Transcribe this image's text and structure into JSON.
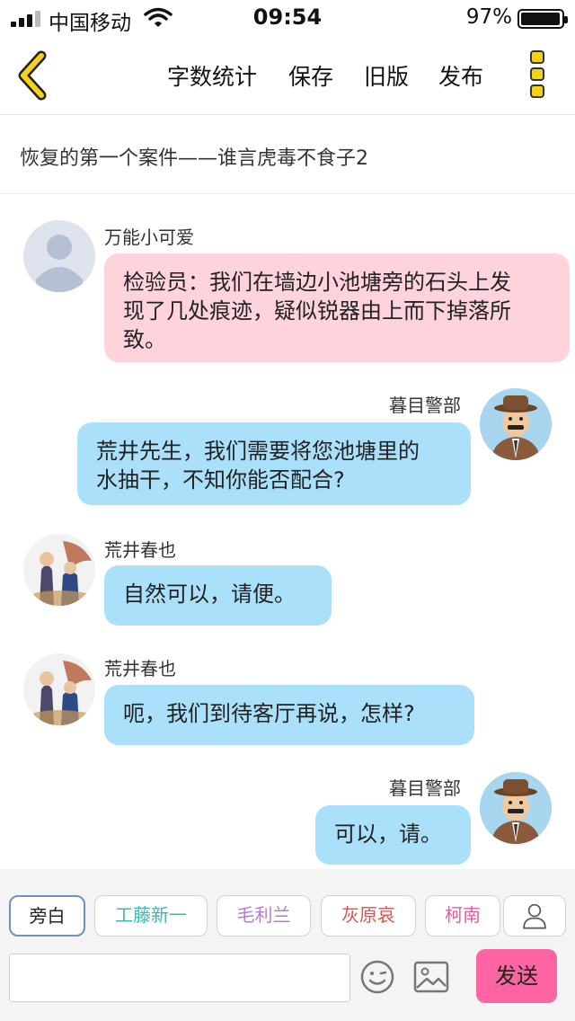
{
  "status_bar": {
    "carrier": "中国移动",
    "time": "09:54",
    "battery_percent": "97%"
  },
  "nav": {
    "items": [
      "字数统计",
      "保存",
      "旧版",
      "发布"
    ]
  },
  "story_title": "恢复的第一个案件——谁言虎毒不食子2",
  "messages": [
    {
      "speaker": "万能小可爱",
      "lines": [
        "检验员：我们在墙边小池塘旁的石头上发",
        "现了几处痕迹，疑似锐器由上而下掉落所",
        "致。"
      ],
      "side": "left",
      "color": "pink",
      "avatar": "default-user-avatar"
    },
    {
      "speaker": "暮目警部",
      "lines": [
        "荒井先生，我们需要将您池塘里的",
        "水抽干，不知你能否配合?"
      ],
      "side": "right",
      "color": "blue",
      "avatar": "inspector-avatar"
    },
    {
      "speaker": "荒井春也",
      "lines": [
        "自然可以，请便。"
      ],
      "side": "left",
      "color": "blue",
      "avatar": "couple-avatar"
    },
    {
      "speaker": "荒井春也",
      "lines": [
        "呃，我们到待客厅再说，怎样?"
      ],
      "side": "left",
      "color": "blue",
      "avatar": "couple-avatar"
    },
    {
      "speaker": "暮目警部",
      "lines": [
        "可以，请。"
      ],
      "side": "right",
      "color": "blue",
      "avatar": "inspector-avatar"
    }
  ],
  "characters": [
    {
      "label": "旁白",
      "color": "#222222",
      "selected": true
    },
    {
      "label": "工藤新一",
      "color": "#3bb8b0",
      "selected": false
    },
    {
      "label": "毛利兰",
      "color": "#b57ad1",
      "selected": false
    },
    {
      "label": "灰原哀",
      "color": "#d9534f",
      "selected": false
    },
    {
      "label": "柯南",
      "color": "#e0609a",
      "selected": false
    }
  ],
  "composer": {
    "placeholder": "",
    "send_label": "发送"
  },
  "colors": {
    "pink_bubble": "#ffd3dc",
    "blue_bubble": "#abe0fb",
    "send_button": "#ff64a2",
    "back_arrow": "#e6c200"
  }
}
